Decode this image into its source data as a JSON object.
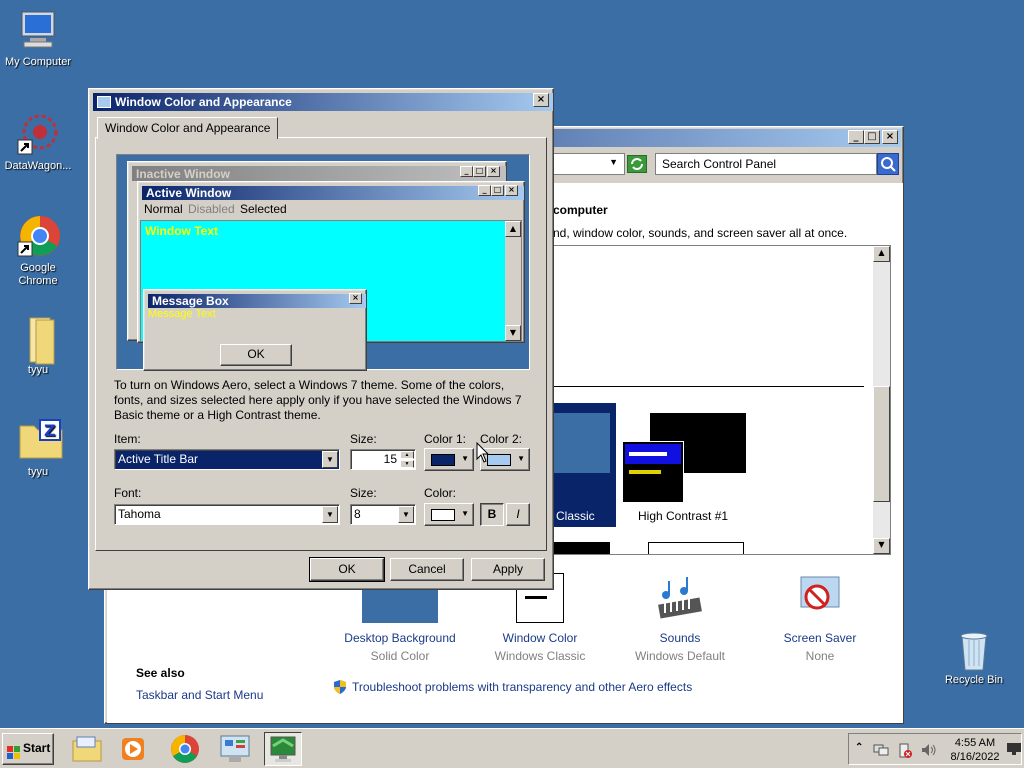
{
  "desktop": {
    "icons": [
      {
        "label": "My Computer"
      },
      {
        "label": "DataWagon..."
      },
      {
        "label": "Google Chrome"
      },
      {
        "label": "tyyu"
      },
      {
        "label": "tyyu"
      },
      {
        "label": "Recycle Bin"
      }
    ]
  },
  "control_panel": {
    "search_placeholder": "Search Control Panel",
    "heading_fragment": "computer",
    "description_fragment": "nd, window color, sounds, and screen saver all at once.",
    "themes": [
      {
        "label": "Classic"
      },
      {
        "label": "High Contrast #1"
      }
    ],
    "bottom_items": [
      {
        "title": "Desktop Background",
        "sub": "Solid Color"
      },
      {
        "title": "Window Color",
        "sub": "Windows Classic"
      },
      {
        "title": "Sounds",
        "sub": "Windows Default"
      },
      {
        "title": "Screen Saver",
        "sub": "None"
      }
    ],
    "see_also": "See also",
    "taskbar_link": "Taskbar and Start Menu",
    "troubleshoot_link": "Troubleshoot problems with transparency and other Aero effects"
  },
  "dialog": {
    "title": "Window Color and Appearance",
    "tab": "Window Color and Appearance",
    "preview": {
      "inactive_title": "Inactive Window",
      "active_title": "Active Window",
      "menu": [
        "Normal",
        "Disabled",
        "Selected"
      ],
      "window_text": "Window Text",
      "msgbox_title": "Message Box",
      "msgbox_text": "Message Text",
      "msgbox_ok": "OK"
    },
    "info_text": "To turn on Windows Aero, select a Windows 7 theme.  Some of the colors, fonts, and sizes selected here apply only if you have selected the Windows 7 Basic theme or a High Contrast theme.",
    "item_label": "Item:",
    "item_value": "Active Title Bar",
    "size_label": "Size:",
    "size_value": "15",
    "color1_label": "Color 1:",
    "color2_label": "Color 2:",
    "color1": "#0a246a",
    "color2": "#a6caf0",
    "font_label": "Font:",
    "font_value": "Tahoma",
    "font_size_label": "Size:",
    "font_size_value": "8",
    "font_color_label": "Color:",
    "font_color": "#ffffff",
    "bold_label": "B",
    "italic_label": "I",
    "ok": "OK",
    "cancel": "Cancel",
    "apply": "Apply"
  },
  "taskbar": {
    "start": "Start",
    "time": "4:55 AM",
    "date": "8/16/2022"
  }
}
